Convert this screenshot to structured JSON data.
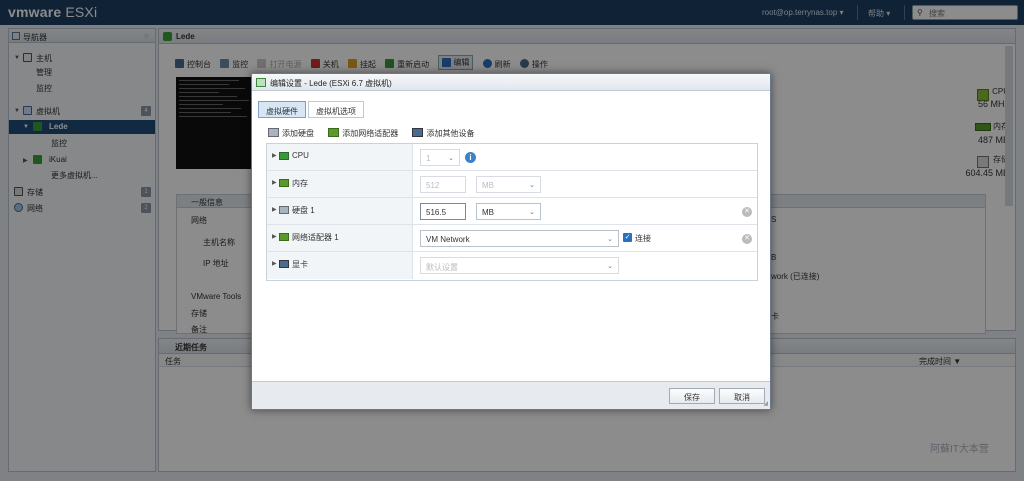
{
  "header": {
    "logo_vm": "vmware",
    "logo_product": "ESXi",
    "user": "root@op.terrynas.top ▾",
    "help": "帮助 ▾",
    "search_placeholder": "搜索"
  },
  "navigator": {
    "title": "导航器",
    "items": [
      {
        "label": "主机"
      },
      {
        "label": "管理"
      },
      {
        "label": "监控"
      },
      {
        "label": "虚拟机",
        "count": "4"
      },
      {
        "label": "Lede"
      },
      {
        "label": "监控"
      },
      {
        "label": "iKuai"
      },
      {
        "label": "更多虚拟机..."
      },
      {
        "label": "存储",
        "count": "1"
      },
      {
        "label": "网络",
        "count": "2"
      }
    ]
  },
  "main": {
    "title": "Lede",
    "toolbar": [
      "控制台",
      "监控",
      "打开电源",
      "关机",
      "挂起",
      "重新启动",
      "编辑",
      "刷新",
      "操作"
    ],
    "metrics": [
      {
        "name": "CPU",
        "value": "56 MHz"
      },
      {
        "name": "内存",
        "value": "487 MB"
      },
      {
        "name": "存储",
        "value": "604.45 MB"
      }
    ],
    "general_info": "一般信息",
    "info_rows": [
      "网络",
      "主机名称",
      "IP 地址",
      "VMware Tools",
      "存储",
      "备注"
    ],
    "right_fragments": [
      "S",
      "B",
      "work (已连接)",
      "卡"
    ]
  },
  "tasks": {
    "title": "近期任务",
    "col_task": "任务",
    "col_done": "完成时间 ▼"
  },
  "watermark": "阿蘇IT大本营",
  "dialog": {
    "title": "编辑设置 - Lede (ESXi 6.7 虚拟机)",
    "tabs": [
      "虚拟硬件",
      "虚拟机选项"
    ],
    "add_buttons": [
      "添加硬盘",
      "添加网络适配器",
      "添加其他设备"
    ],
    "hardware": [
      {
        "label": "CPU",
        "value": "1"
      },
      {
        "label": "内存",
        "value": "512",
        "unit": "MB"
      },
      {
        "label": "硬盘 1",
        "value": "516.5",
        "unit": "MB"
      },
      {
        "label": "网络适配器 1",
        "value": "VM Network",
        "connect_label": "连接"
      },
      {
        "label": "显卡",
        "value": "默认设置"
      }
    ],
    "save": "保存",
    "cancel": "取消"
  },
  "colors": {
    "header_bg": "#1c3e63",
    "selected_nav": "#1f4e79",
    "accent_blue": "#3a83c8",
    "active_tab": "#d7e6f5"
  }
}
